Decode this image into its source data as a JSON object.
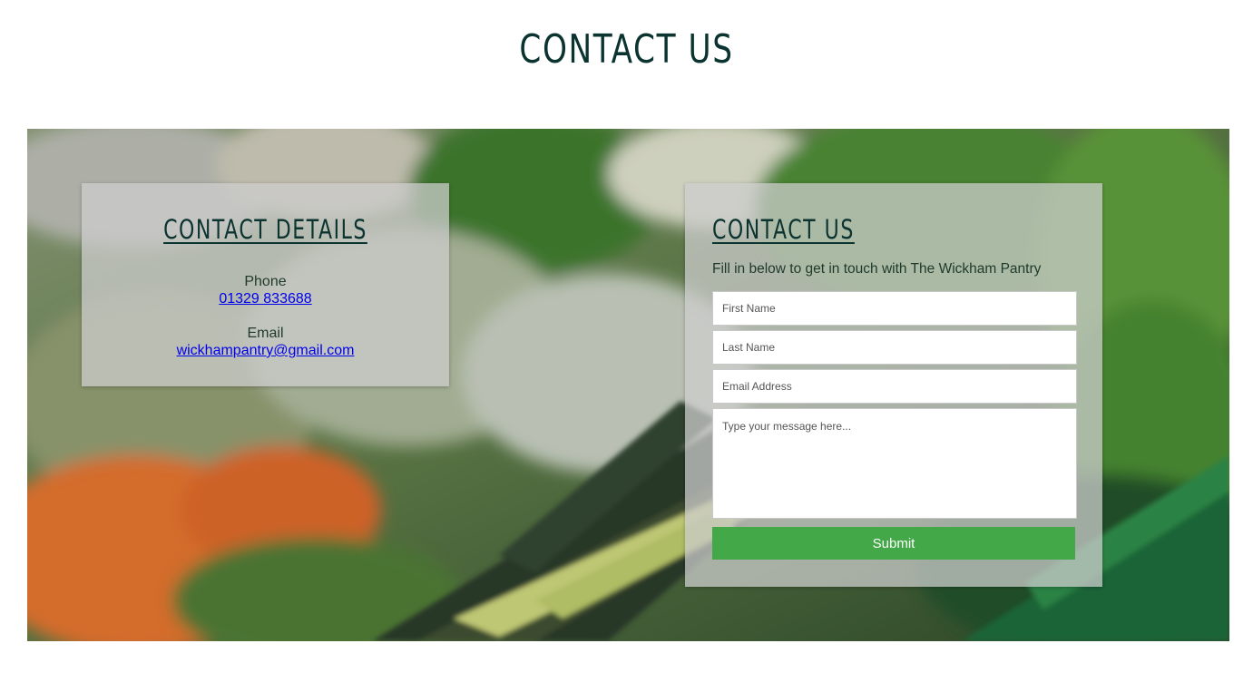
{
  "page": {
    "title": "CONTACT US"
  },
  "hero": {
    "image": "vegetable-market-background"
  },
  "details": {
    "heading": "CONTACT DETAILS",
    "phone_label": "Phone",
    "phone_value": "01329 833688",
    "email_label": "Email",
    "email_value": "wickhampantry@gmail.com"
  },
  "form": {
    "heading": "CONTACT US",
    "intro": "Fill in below to get in touch with The Wickham Pantry",
    "first_name_placeholder": "First Name",
    "last_name_placeholder": "Last Name",
    "email_placeholder": "Email Address",
    "message_placeholder": "Type your message here...",
    "submit_label": "Submit"
  },
  "colors": {
    "heading": "#0b3330",
    "submit": "#43a847",
    "link": "#0000ee"
  }
}
